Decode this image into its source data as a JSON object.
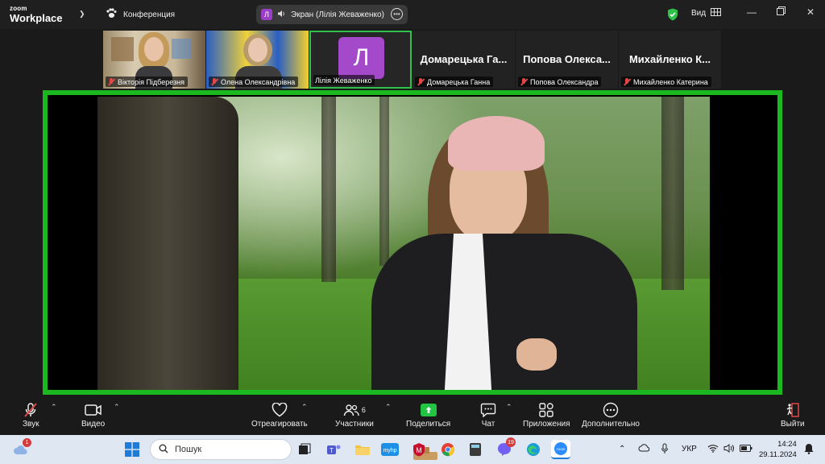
{
  "app": {
    "logo_top": "zoom",
    "logo_bottom": "Workplace"
  },
  "header": {
    "meeting_label": "Конференция",
    "share": {
      "avatar_letter": "Л",
      "label": "Экран (Лілія Жеваженко)"
    },
    "view_label": "Вид"
  },
  "participants": [
    {
      "name": "Вікторія Підберезня",
      "muted": true,
      "type": "video"
    },
    {
      "name": "Олена Олександрівна",
      "muted": true,
      "type": "video"
    },
    {
      "name": "Лілія Жеваженко",
      "muted": false,
      "type": "avatar",
      "avatar_letter": "Л",
      "active": true
    },
    {
      "name": "Домарецька Ганна",
      "display_name": "Домарецька Га...",
      "muted": true,
      "type": "name"
    },
    {
      "name": "Попова Олександра",
      "display_name": "Попова Олекса...",
      "muted": true,
      "type": "name"
    },
    {
      "name": "Михайленко Катерина",
      "display_name": "Михайленко К...",
      "muted": true,
      "type": "name"
    }
  ],
  "toolbar": {
    "audio_label": "Звук",
    "video_label": "Видео",
    "react_label": "Отреагировать",
    "participants_label": "Участники",
    "participants_count": "6",
    "share_label": "Поделиться",
    "chat_label": "Чат",
    "apps_label": "Приложения",
    "more_label": "Дополнительно",
    "leave_label": "Выйти"
  },
  "taskbar": {
    "search_placeholder": "Пошук",
    "weather_badge": "1",
    "viber_badge": "19",
    "language": "УКР",
    "time": "14:24",
    "date": "29.11.2024"
  },
  "colors": {
    "active_border": "#1bb81f",
    "avatar": "#a349c9",
    "share_green": "#23c343",
    "muted_red": "#e04848"
  }
}
